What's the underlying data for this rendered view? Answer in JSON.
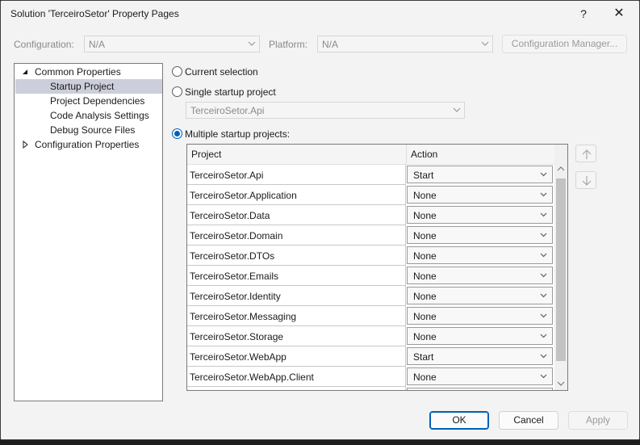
{
  "window": {
    "title": "Solution 'TerceiroSetor' Property Pages",
    "help_glyph": "?",
    "close_glyph": "✕"
  },
  "toolbar": {
    "configuration_label": "Configuration:",
    "configuration_value": "N/A",
    "platform_label": "Platform:",
    "platform_value": "N/A",
    "config_manager_label": "Configuration Manager..."
  },
  "tree": {
    "items": [
      {
        "label": "Common Properties",
        "expanded": true,
        "selected": false
      },
      {
        "label": "Startup Project",
        "selected": true
      },
      {
        "label": "Project Dependencies",
        "selected": false
      },
      {
        "label": "Code Analysis Settings",
        "selected": false
      },
      {
        "label": "Debug Source Files",
        "selected": false
      },
      {
        "label": "Configuration Properties",
        "expanded": false,
        "selected": false
      }
    ]
  },
  "startup": {
    "current_selection_label": "Current selection",
    "single_label": "Single startup project",
    "single_value": "TerceiroSetor.Api",
    "multiple_label": "Multiple startup projects:",
    "selected_option": "multiple"
  },
  "grid": {
    "col_project": "Project",
    "col_action": "Action",
    "rows": [
      {
        "project": "TerceiroSetor.Api",
        "action": "Start"
      },
      {
        "project": "TerceiroSetor.Application",
        "action": "None"
      },
      {
        "project": "TerceiroSetor.Data",
        "action": "None"
      },
      {
        "project": "TerceiroSetor.Domain",
        "action": "None"
      },
      {
        "project": "TerceiroSetor.DTOs",
        "action": "None"
      },
      {
        "project": "TerceiroSetor.Emails",
        "action": "None"
      },
      {
        "project": "TerceiroSetor.Identity",
        "action": "None"
      },
      {
        "project": "TerceiroSetor.Messaging",
        "action": "None"
      },
      {
        "project": "TerceiroSetor.Storage",
        "action": "None"
      },
      {
        "project": "TerceiroSetor.WebApp",
        "action": "Start"
      },
      {
        "project": "TerceiroSetor.WebApp.Client",
        "action": "None"
      }
    ]
  },
  "footer": {
    "ok_label": "OK",
    "cancel_label": "Cancel",
    "apply_label": "Apply"
  },
  "colors": {
    "accent": "#005fb8",
    "selection": "#cccedb",
    "background": "#f3f3f3"
  }
}
